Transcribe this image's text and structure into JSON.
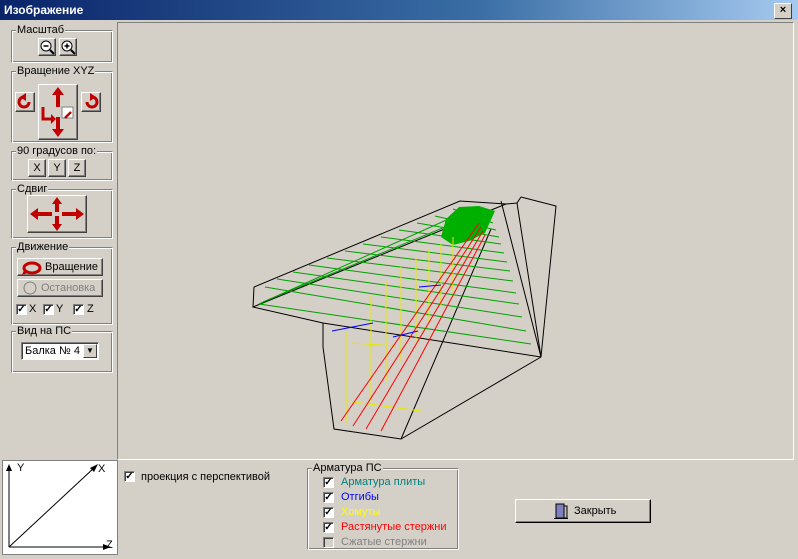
{
  "window": {
    "title": "Изображение",
    "close_label": "×"
  },
  "scale": {
    "label": "Масштаб"
  },
  "rotation_xyz": {
    "label": "Вращение XYZ"
  },
  "rot90": {
    "label": "90 градусов по:",
    "x": "X",
    "y": "Y",
    "z": "Z"
  },
  "shift": {
    "label": "Сдвиг"
  },
  "motion": {
    "label": "Движение",
    "rotate_label": "Вращение",
    "stop_label": "Остановка",
    "x": "X",
    "y": "Y",
    "z": "Z"
  },
  "view": {
    "label": "Вид на ПС",
    "selected": "Балка № 4"
  },
  "axes": {
    "x": "X",
    "y": "Y",
    "z": "Z"
  },
  "perspective": {
    "label": "проекция с перспективой",
    "checked": true
  },
  "rebar": {
    "label": "Арматура ПС",
    "items": [
      {
        "label": "Арматура плиты",
        "color": "#008080",
        "checked": true,
        "enabled": true
      },
      {
        "label": "Отгибы",
        "color": "#0000ff",
        "checked": true,
        "enabled": true
      },
      {
        "label": "Хомуты",
        "color": "#ffff00",
        "checked": true,
        "enabled": true
      },
      {
        "label": "Растянутые стержни",
        "color": "#ff0000",
        "checked": true,
        "enabled": true
      },
      {
        "label": "Сжатые стержни",
        "color": "#808080",
        "checked": false,
        "enabled": false
      }
    ]
  },
  "close_button": {
    "label": "Закрыть"
  }
}
